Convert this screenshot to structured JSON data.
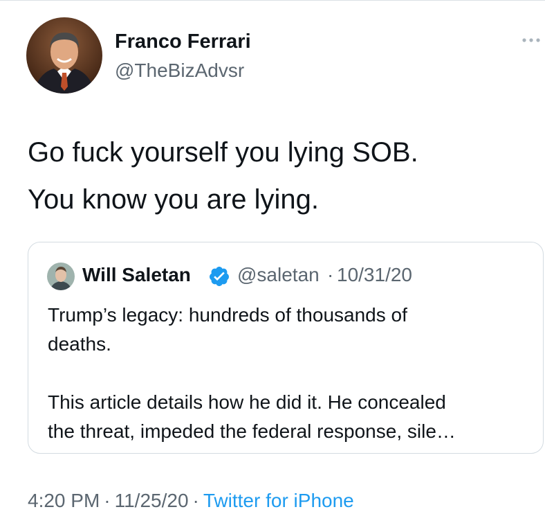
{
  "tweet": {
    "author": {
      "name": "Franco Ferrari",
      "handle": "@TheBizAdvsr",
      "avatar_icon": "avatar-photo"
    },
    "text_lines": [
      "Go fuck yourself you lying SOB.",
      "You know you are lying."
    ],
    "more_icon": "ellipsis-icon",
    "time": "4:20 PM",
    "date": "11/25/20",
    "source": "Twitter for iPhone",
    "separator": "·"
  },
  "quote": {
    "name": "Will Saletan",
    "verified": true,
    "handle": "@saletan",
    "separator": "·",
    "date": "10/31/20",
    "text_lines_1": [
      "Trump’s legacy: hundreds of thousands of",
      "deaths."
    ],
    "text_lines_2": [
      "This article details how he did it. He concealed",
      "the threat, impeded the federal response, sile…"
    ]
  },
  "colors": {
    "text_primary": "#0f1419",
    "text_secondary": "#5b6670",
    "link": "#1d9bf0",
    "verified": "#1d9bf0",
    "border": "#d3dbe1"
  }
}
